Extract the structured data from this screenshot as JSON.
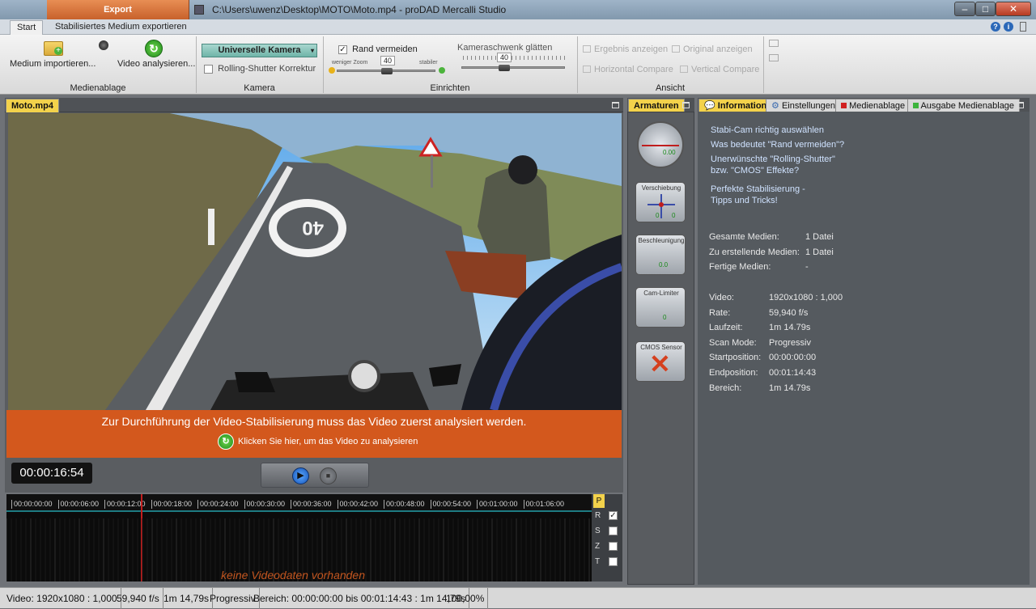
{
  "window": {
    "title": "C:\\Users\\uwenz\\Desktop\\MOTO\\Moto.mp4 - proDAD Mercalli Studio",
    "export_tab": "Export",
    "buttons": {
      "minimize": "–",
      "maximize": "□",
      "close": "✕"
    }
  },
  "ribbon_tabs": [
    "Start",
    "Stabilisiertes Medium exportieren"
  ],
  "help_icons": [
    "?",
    "i"
  ],
  "ribbon": {
    "medienablage": {
      "import_label": "Medium importieren...",
      "analyze_label": "Video analysieren...",
      "group_label": "Medienablage"
    },
    "kamera": {
      "camera_select": "Universelle Kamera",
      "rolling_shutter_label": "Rolling-Shutter Korrektur",
      "rolling_shutter_checked": false,
      "group_label": "Kamera"
    },
    "einrichten": {
      "rand_label": "Rand vermeiden",
      "rand_checked": true,
      "rand_value": "40",
      "less_zoom": "weniger Zoom",
      "more_stable": "stabiler",
      "schwenk_label": "Kameraschwenk glätten",
      "schwenk_value": "40",
      "group_label": "Einrichten"
    },
    "ansicht": {
      "ergebnis": "Ergebnis anzeigen",
      "original": "Original anzeigen",
      "horizontal": "Horizontal Compare",
      "vertical": "Vertical Compare",
      "group_label": "Ansicht"
    }
  },
  "video_panel": {
    "tab": "Moto.mp4",
    "road_marking": "40",
    "overlay_message": "Zur Durchführung der Video-Stabilisierung muss das Video zuerst analysiert werden.",
    "overlay_link": "Klicken Sie hier, um das Video zu analysieren",
    "timecode": "00:00:16:54"
  },
  "timeline": {
    "ticks": [
      "00:00:00:00",
      "00:00:06:00",
      "00:00:12:00",
      "00:00:18:00",
      "00:00:24:00",
      "00:00:30:00",
      "00:00:36:00",
      "00:00:42:00",
      "00:00:48:00",
      "00:00:54:00",
      "00:01:00:00",
      "00:01:06:00"
    ],
    "no_data": "keine Videodaten vorhanden",
    "p_button": "P",
    "tracks": [
      {
        "label": "R",
        "checked": true
      },
      {
        "label": "S",
        "checked": false
      },
      {
        "label": "Z",
        "checked": false
      },
      {
        "label": "T",
        "checked": false
      }
    ],
    "playhead_fraction": 0.23
  },
  "armaturen": {
    "tab": "Armaturen",
    "gauges": [
      {
        "label": "",
        "value": "0.00"
      },
      {
        "label": "Verschiebung",
        "value_x": "0",
        "value_y": "0"
      },
      {
        "label": "Beschleunigung",
        "value": "0.0"
      },
      {
        "label": "Cam-Limiter",
        "value": "0"
      },
      {
        "label": "CMOS Sensor",
        "value": ""
      }
    ]
  },
  "info_panel": {
    "tabs": [
      "Information",
      "Einstellungen",
      "Medienablage",
      "Ausgabe Medienablage"
    ],
    "links": [
      "Stabi-Cam richtig auswählen",
      "Was bedeutet \"Rand vermeiden\"?",
      "Unerwünschte \"Rolling-Shutter\"\nbzw. \"CMOS\" Effekte?",
      "Perfekte Stabilisierung -\nTipps und Tricks!"
    ],
    "media_stats": [
      {
        "key": "Gesamte Medien:",
        "value": "1 Datei"
      },
      {
        "key": "Zu erstellende Medien:",
        "value": "1 Datei"
      },
      {
        "key": "Fertige Medien:",
        "value": "-"
      }
    ],
    "video_stats": [
      {
        "key": "Video:",
        "value": "1920x1080 : 1,000"
      },
      {
        "key": "Rate:",
        "value": "59,940 f/s"
      },
      {
        "key": "Laufzeit:",
        "value": "1m 14.79s"
      },
      {
        "key": "Scan Mode:",
        "value": "Progressiv"
      },
      {
        "key": "Startposition:",
        "value": "00:00:00:00"
      },
      {
        "key": "Endposition:",
        "value": "00:01:14:43"
      },
      {
        "key": "Bereich:",
        "value": "1m 14.79s"
      }
    ]
  },
  "statusbar": [
    "Video: 1920x1080 : 1,000",
    "59,940 f/s",
    "1m 14,79s",
    "Progressiv",
    "Bereich: 00:00:00:00 bis 00:01:14:43 : 1m 14,79s",
    "100,00%"
  ]
}
